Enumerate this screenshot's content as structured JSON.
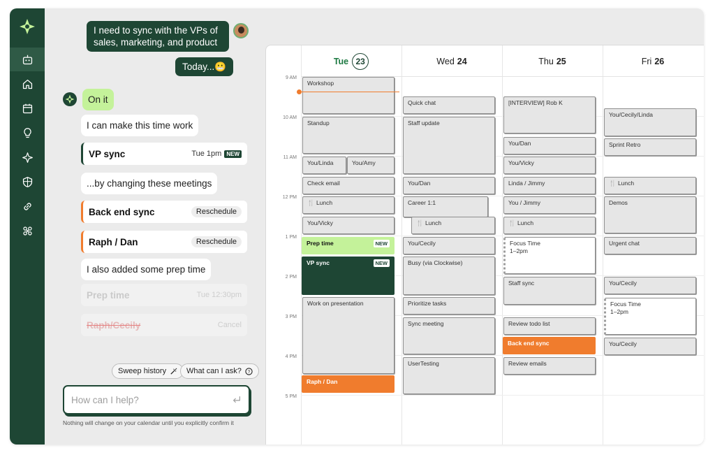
{
  "colors": {
    "brand_dark": "#1e4634",
    "accent_lime": "#c4f29a",
    "accent_orange": "#f07c2d"
  },
  "sidebar": {
    "logo_icon": "clockwise-logo-icon",
    "items": [
      {
        "icon": "robot-icon",
        "active": true
      },
      {
        "icon": "home-icon"
      },
      {
        "icon": "calendar-icon"
      },
      {
        "icon": "lightbulb-icon"
      },
      {
        "icon": "sparkle-icon"
      },
      {
        "icon": "shield-icon"
      },
      {
        "icon": "link-icon"
      },
      {
        "icon": "integrations-icon"
      }
    ]
  },
  "chat": {
    "user_message_1": "I need to sync with the VPs of sales, marketing, and product",
    "user_message_2": "Today...😬",
    "bot_on_it": "On it",
    "bot_can_make": "I can make this time work",
    "vp_sync": {
      "title": "VP sync",
      "time": "Tue 1pm",
      "badge": "NEW"
    },
    "bot_changing": "...by changing these meetings",
    "back_end_sync": {
      "title": "Back end sync",
      "action": "Reschedule"
    },
    "raph_dan": {
      "title": "Raph / Dan",
      "action": "Reschedule"
    },
    "bot_added_prep": "I also added some prep time",
    "prep_time": {
      "title": "Prep time",
      "time": "Tue 12:30pm"
    },
    "raph_cecily": {
      "title": "Raph/Cecily",
      "action": "Cancel"
    },
    "chip_sweep": "Sweep history",
    "chip_ask": "What can I ask?",
    "input_placeholder": "How can I help?",
    "disclaimer": "Nothing will change on your calendar until you explicitly confirm it"
  },
  "calendar": {
    "days": [
      {
        "dow": "Tue",
        "date": "23",
        "today": true
      },
      {
        "dow": "Wed",
        "date": "24"
      },
      {
        "dow": "Thu",
        "date": "25"
      },
      {
        "dow": "Fri",
        "date": "26"
      }
    ],
    "hours": [
      "9 AM",
      "10 AM",
      "11 AM",
      "12 PM",
      "1 PM",
      "2 PM",
      "3 PM",
      "4 PM",
      "5 PM"
    ],
    "events": {
      "tue": [
        "Workshop",
        "Standup",
        "You/Linda",
        "You/Amy",
        "Check email",
        "🍴 Lunch",
        "You/Vicky",
        "Prep time",
        "VP sync",
        "Work on presentation",
        "Raph / Dan"
      ],
      "tue_badges": {
        "prep": "NEW",
        "vp": "NEW"
      },
      "wed": [
        "Quick chat",
        "Staff update",
        "You/Dan",
        "Career 1:1",
        "🍴 Lunch",
        "You/Cecily",
        "Busy (via Clockwise)",
        "Prioritize tasks",
        "Sync meeting",
        "UserTesting"
      ],
      "thu": [
        "[INTERVIEW] Rob K",
        "You/Dan",
        "You/Vicky",
        "Linda / Jimmy",
        "You / Jimmy",
        "🍴 Lunch",
        "Focus Time",
        "1–2pm",
        "Staff sync",
        "Review todo list",
        "Back end sync",
        "Review emails"
      ],
      "fri": [
        "You/Cecily/Linda",
        "Sprint Retro",
        "🍴 Lunch",
        "Demos",
        "Urgent chat",
        "You/Cecily",
        "Focus Time",
        "1–2pm",
        "You/Cecily"
      ]
    }
  }
}
